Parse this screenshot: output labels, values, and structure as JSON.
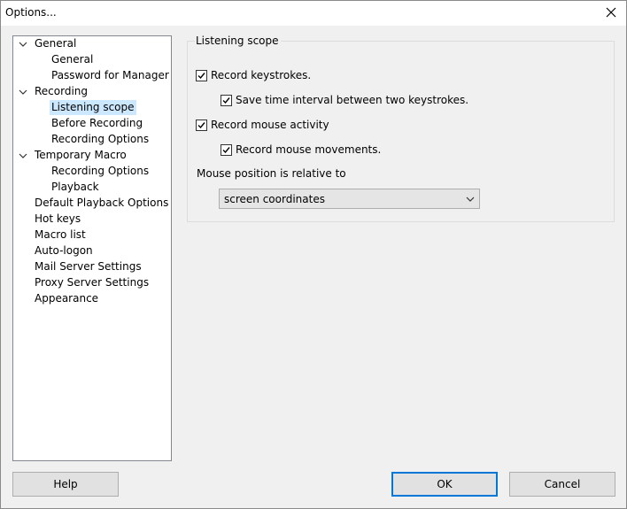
{
  "window": {
    "title": "Options...",
    "close_glyph": "close-icon"
  },
  "tree": {
    "items": [
      {
        "label": "General",
        "expanded": true
      },
      {
        "label": "General"
      },
      {
        "label": "Password for Manager"
      },
      {
        "label": "Recording",
        "expanded": true
      },
      {
        "label": "Listening scope",
        "selected": true
      },
      {
        "label": "Before Recording"
      },
      {
        "label": "Recording Options"
      },
      {
        "label": "Temporary Macro",
        "expanded": true
      },
      {
        "label": "Recording Options"
      },
      {
        "label": "Playback"
      },
      {
        "label": "Default Playback Options"
      },
      {
        "label": "Hot keys"
      },
      {
        "label": "Macro list"
      },
      {
        "label": "Auto-logon"
      },
      {
        "label": "Mail Server Settings"
      },
      {
        "label": "Proxy Server Settings"
      },
      {
        "label": "Appearance"
      }
    ]
  },
  "panel": {
    "group_title": "Listening scope",
    "record_keystrokes": {
      "label": "Record keystrokes.",
      "checked": true
    },
    "save_time_interval": {
      "label": "Save time interval between two keystrokes.",
      "checked": true
    },
    "record_mouse_activity": {
      "label": "Record mouse activity",
      "checked": true
    },
    "record_mouse_movements": {
      "label": "Record mouse movements.",
      "checked": true
    },
    "mouse_position_label": "Mouse position is relative to",
    "mouse_position_value": "screen coordinates"
  },
  "buttons": {
    "help": "Help",
    "ok": "OK",
    "cancel": "Cancel"
  },
  "colors": {
    "selection": "#cce8ff",
    "default_button_border": "#0078d7"
  }
}
